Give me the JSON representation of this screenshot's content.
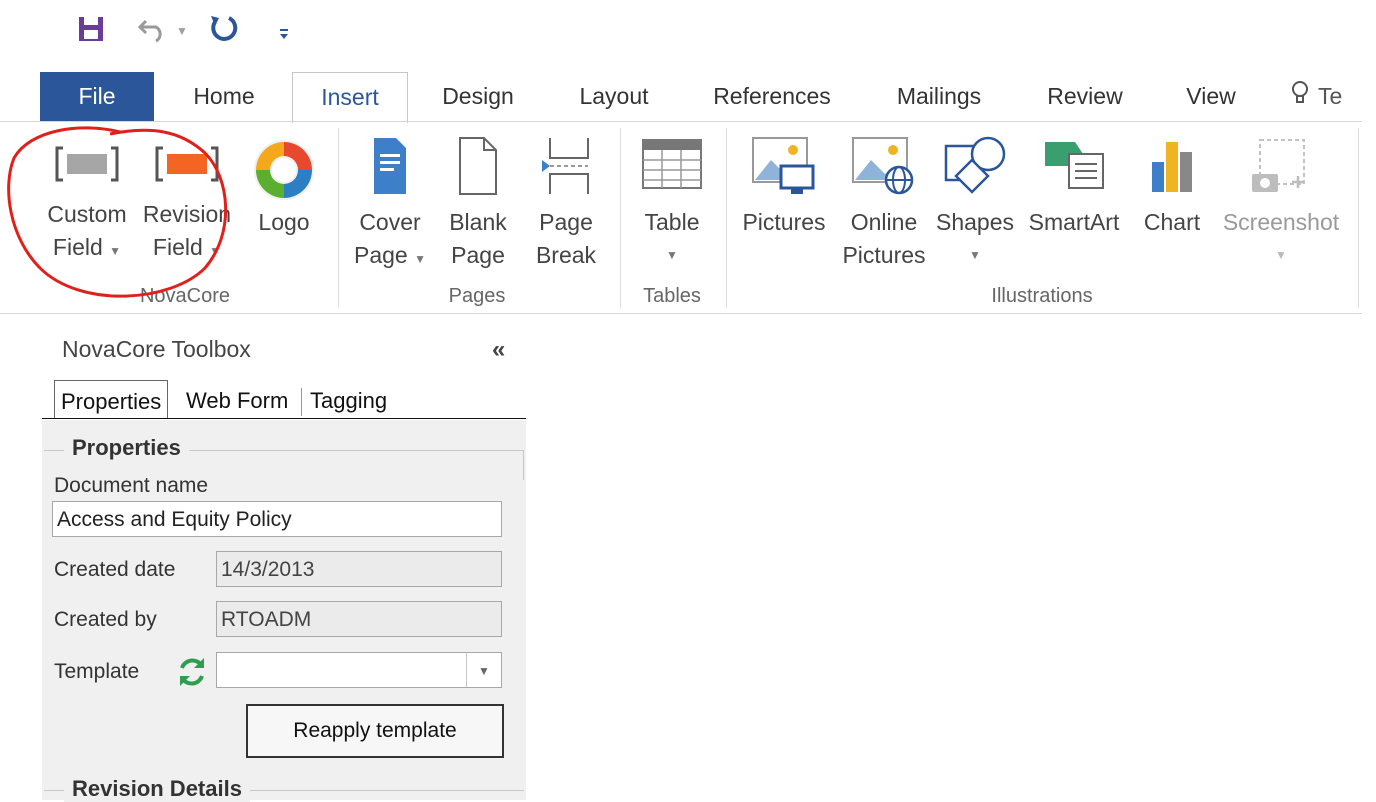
{
  "quick_access": {
    "save_icon": "save-icon",
    "undo_icon": "undo-icon",
    "redo_icon": "repeat-icon",
    "customize_icon": "customize-qat-icon"
  },
  "tabs": {
    "file": "File",
    "home": "Home",
    "insert": "Insert",
    "design": "Design",
    "layout": "Layout",
    "references": "References",
    "mailings": "Mailings",
    "review": "Review",
    "view": "View",
    "tell_me": "Te"
  },
  "ribbon": {
    "novacore": {
      "group_label": "NovaCore",
      "custom_field": [
        "Custom",
        "Field"
      ],
      "revision_field": [
        "Revision",
        "Field"
      ],
      "logo": "Logo"
    },
    "pages": {
      "group_label": "Pages",
      "cover_page": [
        "Cover",
        "Page"
      ],
      "blank_page": [
        "Blank",
        "Page"
      ],
      "page_break": [
        "Page",
        "Break"
      ]
    },
    "tables": {
      "group_label": "Tables",
      "table": "Table"
    },
    "illustrations": {
      "group_label": "Illustrations",
      "pictures": "Pictures",
      "online_pictures": [
        "Online",
        "Pictures"
      ],
      "shapes": "Shapes",
      "smartart": "SmartArt",
      "chart": "Chart",
      "screenshot": "Screenshot"
    }
  },
  "colors": {
    "file_tab": "#2b579a",
    "annotation": "#e0201b",
    "revision_orange": "#f26522",
    "template_refresh": "#2e9e4f"
  },
  "toolbox": {
    "title": "NovaCore Toolbox",
    "collapse": "«",
    "tabs": [
      "Properties",
      "Web Form",
      "Tagging"
    ],
    "properties_heading": "Properties",
    "doc_name_label": "Document name",
    "doc_name_value": "Access and Equity Policy",
    "created_date_label": "Created date",
    "created_date_value": "14/3/2013",
    "created_by_label": "Created by",
    "created_by_value": "RTOADM",
    "template_label": "Template",
    "template_value": "",
    "reapply_button": "Reapply template",
    "revision_heading": "Revision Details"
  }
}
